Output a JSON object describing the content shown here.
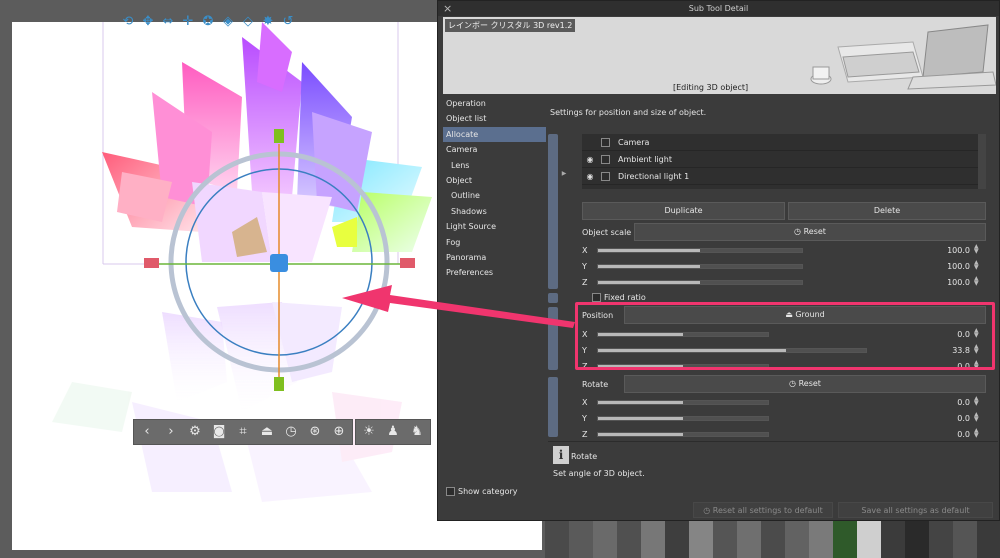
{
  "dialog": {
    "title": "Sub Tool Detail",
    "close_glyph": "×",
    "preview": {
      "name": "レインボー クリスタル 3D rev1.2",
      "status": "[Editing 3D object]"
    },
    "nav": {
      "items": [
        {
          "label": "Operation"
        },
        {
          "label": "Object list"
        },
        {
          "label": "Allocate"
        },
        {
          "label": "Camera"
        },
        {
          "label": "Lens"
        },
        {
          "label": "Object"
        },
        {
          "label": "Outline"
        },
        {
          "label": "Shadows"
        },
        {
          "label": "Light Source"
        },
        {
          "label": "Fog"
        },
        {
          "label": "Panorama"
        },
        {
          "label": "Preferences"
        }
      ],
      "active": "Allocate",
      "show_category": "Show category"
    },
    "content": {
      "description": "Settings for position and size of object.",
      "layers": [
        {
          "name": "Camera",
          "visible": false
        },
        {
          "name": "Ambient light",
          "visible": true
        },
        {
          "name": "Directional light 1",
          "visible": true
        }
      ],
      "duplicate_label": "Duplicate",
      "delete_label": "Delete",
      "object_scale": {
        "label": "Object scale",
        "reset_label": "Reset",
        "x": "100.0",
        "y": "100.0",
        "z": "100.0",
        "x_fill": 0.5,
        "y_fill": 0.5,
        "z_fill": 0.5,
        "axis_x": "X",
        "axis_y": "Y",
        "axis_z": "Z"
      },
      "fixed_ratio": "Fixed ratio",
      "position": {
        "label": "Position",
        "ground_label": "Ground",
        "x": "0.0",
        "y": "33.8",
        "z": "0.0",
        "x_fill": 0.5,
        "y_fill": 0.7,
        "z_fill": 0.5,
        "axis_x": "X",
        "axis_y": "Y",
        "axis_z": "Z"
      },
      "rotate": {
        "label": "Rotate",
        "reset_label": "Reset",
        "x": "0.0",
        "y": "0.0",
        "z": "0.0",
        "x_fill": 0.5,
        "y_fill": 0.5,
        "z_fill": 0.5,
        "axis_x": "X",
        "axis_y": "Y",
        "axis_z": "Z"
      }
    },
    "help": {
      "icon": "i",
      "title": "Rotate",
      "description": "Set angle of 3D object."
    },
    "footer": {
      "reset_all": "Reset all settings to default",
      "save_all": "Save all settings as default"
    }
  },
  "colors": {
    "highlight": "#f0356e",
    "nav_active": "#5b6f8f",
    "gizmo_ring": "#3a7fc1",
    "gizmo_y": "#7fbf1f",
    "gizmo_x": "#e05a6a"
  },
  "icons": {
    "top_toolbar": [
      "rotate-camera-icon",
      "pan-camera-icon",
      "zoom-camera-icon",
      "move-icon",
      "rotate-object-icon",
      "scale-object-icon",
      "tilt-object-icon",
      "reset-icon",
      "undo-icon"
    ],
    "bottom_toolbar": [
      "prev-icon",
      "next-icon",
      "wrench-icon",
      "camera-icon",
      "fit-icon",
      "ground-icon",
      "clock-icon",
      "lock-icon",
      "material-icon",
      "light-icon",
      "pose-icon",
      "pose-2-icon"
    ]
  }
}
